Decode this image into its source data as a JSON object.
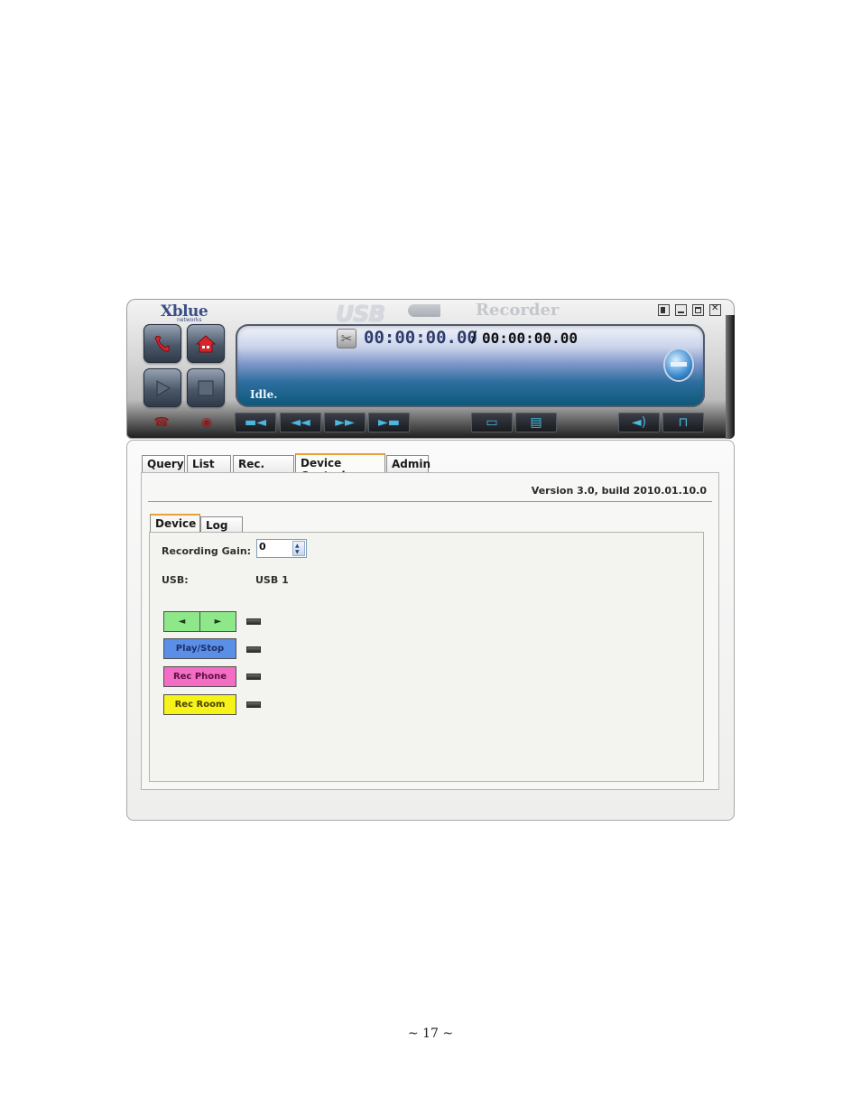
{
  "header": {
    "brand": "Xblue",
    "brand_sub": "networks",
    "product": "USB",
    "product_name": "Recorder",
    "time_current": "00:00:00.00",
    "time_separator": "/",
    "time_total": "00:00:00.00",
    "status": "Idle."
  },
  "icons": {
    "phone": "phone-icon",
    "home": "house-icon",
    "play": "play-icon",
    "stop": "stop-icon",
    "scissors": "scissors-icon"
  },
  "tabs": [
    "Query",
    "List",
    "Rec. Data",
    "Device Control",
    "Admin"
  ],
  "active_tab": "Device Control",
  "version_text": "Version 3.0, build 2010.01.10.0",
  "subtabs": [
    "Device",
    "Log"
  ],
  "device": {
    "recording_gain_label": "Recording Gain:",
    "recording_gain_value": "0",
    "usb_label": "USB:",
    "usb_value": "USB 1",
    "buttons": {
      "prev": "◄",
      "next": "►",
      "play_stop": "Play/Stop",
      "rec_phone": "Rec Phone",
      "rec_room": "Rec Room"
    }
  },
  "colors": {
    "arrows": "#8ee88a",
    "play_stop": "#5b8ee6",
    "rec_phone": "#f36dc4",
    "rec_room": "#f5f31a",
    "tab_accent": "#e9a23b"
  },
  "page_number": "~ 17 ~"
}
